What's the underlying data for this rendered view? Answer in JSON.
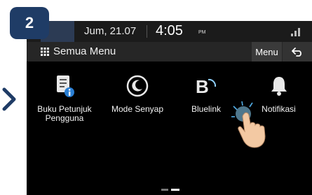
{
  "step": "2",
  "status_bar": {
    "date": "Jum, 21.07",
    "time": "4:05",
    "ampm": "PM"
  },
  "title_bar": {
    "title": "Semua Menu",
    "menu_label": "Menu"
  },
  "menu_items": [
    {
      "line1": "Buku Petunjuk",
      "line2": "Pengguna",
      "icon": "manual-info-icon"
    },
    {
      "line1": "Mode Senyap",
      "line2": "",
      "icon": "moon-icon"
    },
    {
      "line1": "Bluelink",
      "line2": "",
      "icon": "bluelink-icon"
    },
    {
      "line1": "Notifikasi",
      "line2": "",
      "icon": "bell-icon"
    }
  ],
  "colors": {
    "step_badge": "#1f3c66",
    "screen_bg": "#000000",
    "title_bar": "#262626",
    "accent": "#e05a00"
  }
}
